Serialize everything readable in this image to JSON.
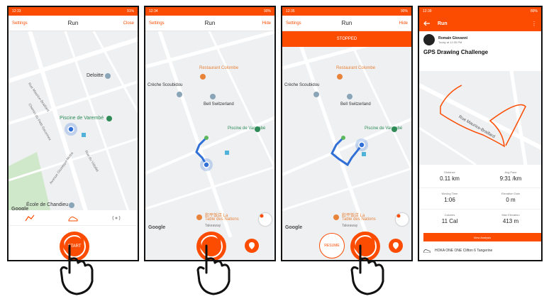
{
  "screens": [
    {
      "status": {
        "time": "12:33",
        "right": "91%"
      },
      "appbar": {
        "left": "Settings",
        "title": "Run",
        "right": "Close"
      },
      "map_labels": {
        "deloitte": "Deloitte",
        "piscine": "Piscine de Varembé",
        "ecole": "École de Chandieu",
        "rue_maurice": "Rue Maurice-Braillard",
        "chemin": "Chemin du Petit-Saconnex",
        "avenue": "Avenue Giuseppe-Motta",
        "rue_vidollet": "Rue du Vidollet",
        "google": "Google"
      },
      "button": {
        "label": "START"
      }
    },
    {
      "status": {
        "time": "12:34",
        "right": "90%"
      },
      "appbar": {
        "left": "Settings",
        "title": "Run",
        "right": "Hide"
      },
      "map_labels": {
        "restaurant": "Restaurant Colombe",
        "creche": "Crèche Scoubidou",
        "bell": "Bell Switzerland",
        "piscine": "Piscine de Varembé",
        "nations_cn": "和平饭店 La",
        "nations": "Table des Nations",
        "takeaway": "Takeaway",
        "google": "Google"
      }
    },
    {
      "status": {
        "time": "12:35",
        "right": "90%"
      },
      "appbar": {
        "left": "Settings",
        "title": "Run",
        "right": "Hide"
      },
      "banner": "STOPPED",
      "map_labels": {
        "restaurant": "Restaurant Colombe",
        "creche": "Crèche Scoubidou",
        "bell": "Bell Switzerland",
        "piscine": "Piscine de Varembé",
        "nations_cn": "和平饭店 La",
        "nations": "Table des Nations",
        "takeaway": "Takeaway",
        "google": "Google"
      },
      "resume": "RESUME",
      "finish": "FINISH"
    },
    {
      "status": {
        "time": "12:39",
        "right": "89%"
      },
      "appbar": {
        "title": "Run"
      },
      "athlete": "Romain Giovanni",
      "date": "Today at 12:35 PM",
      "activity_title": "GPS Drawing Challenge",
      "map_label": "Rue Maurice-Braillard",
      "stats": [
        {
          "label": "Distance",
          "value": "0.11 km"
        },
        {
          "label": "Avg Pace",
          "value": "9:31 /km"
        },
        {
          "label": "Moving Time",
          "value": "1:06"
        },
        {
          "label": "Elevation Gain",
          "value": "0 m"
        },
        {
          "label": "Calories",
          "value": "11 Cal"
        },
        {
          "label": "Max Elevation",
          "value": "413 m"
        }
      ],
      "view_analysis": "View Analysis",
      "gear": "HOKA ONE ONE Clifton 6 Tangerine"
    }
  ],
  "colors": {
    "accent": "#fc4c02",
    "route": "#2f6fd6",
    "water": "#2e8b57"
  }
}
